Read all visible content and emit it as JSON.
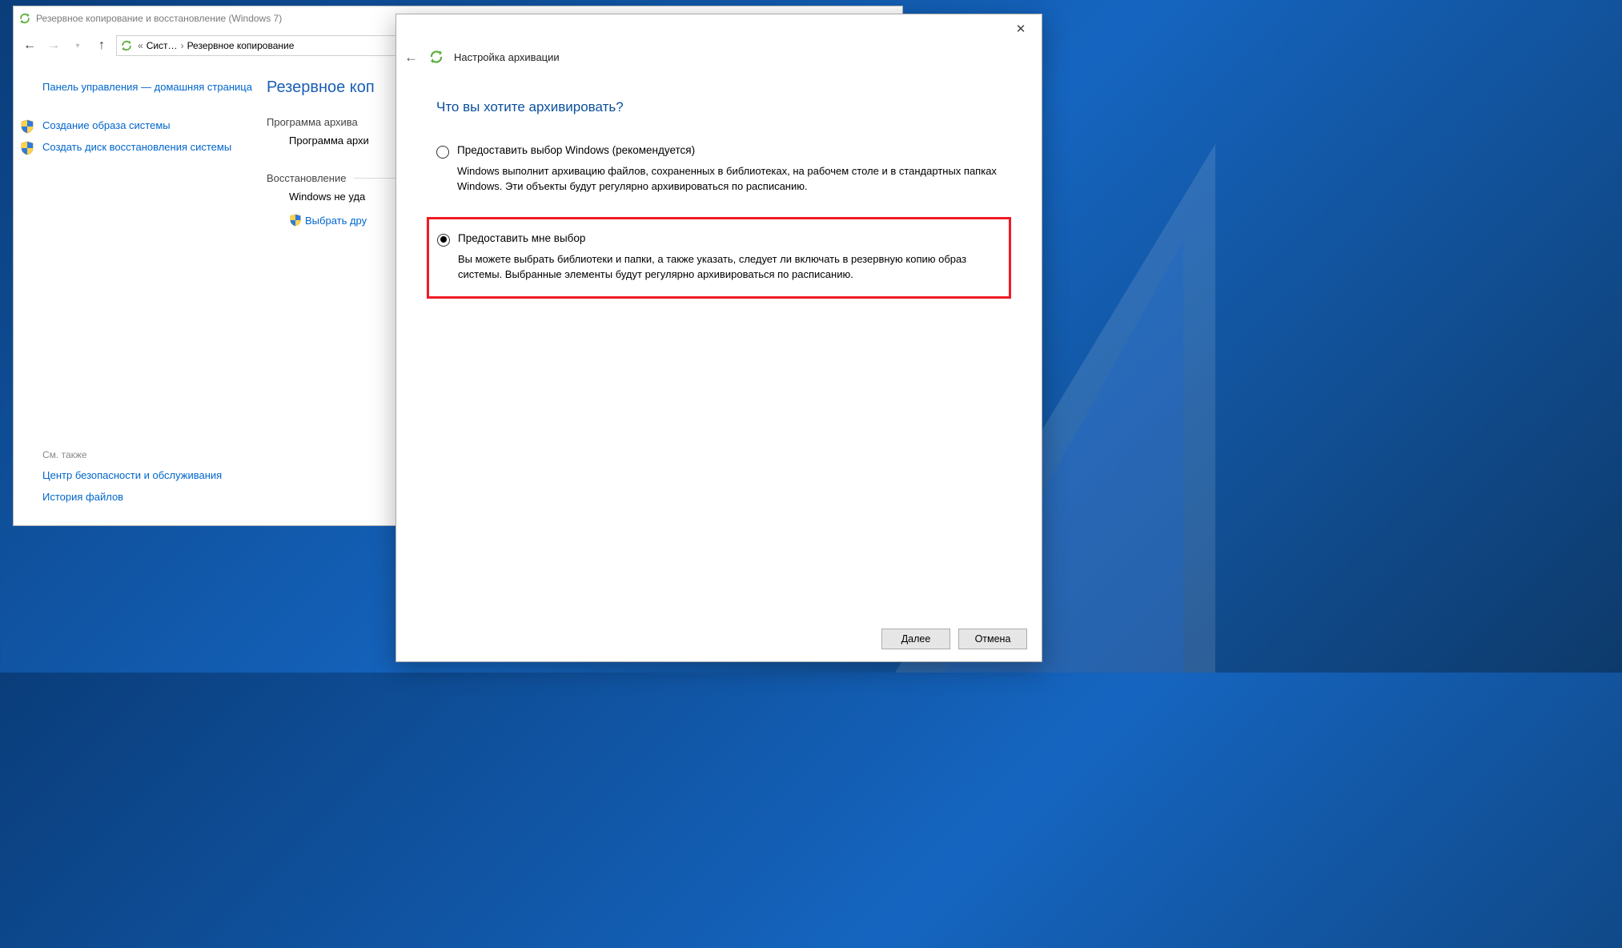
{
  "parent_window": {
    "title": "Резервное копирование и восстановление (Windows 7)",
    "breadcrumb": {
      "item1": "Сист…",
      "item2": "Резервное копирование"
    },
    "sidebar": {
      "home": "Панель управления — домашняя страница",
      "create_image": "Создание образа системы",
      "create_recovery_disk": "Создать диск восстановления системы",
      "see_also_label": "См. также",
      "security_center": "Центр безопасности и обслуживания",
      "file_history": "История файлов"
    },
    "main": {
      "title": "Резервное коп",
      "backup_section": "Программа архива",
      "backup_subline": "Программа архи",
      "restore_section": "Восстановление",
      "restore_line": "Windows не уда",
      "restore_link": "Выбрать дру"
    }
  },
  "dialog": {
    "header": "Настройка архивации",
    "heading": "Что вы хотите архивировать?",
    "option1": {
      "label": "Предоставить выбор Windows (рекомендуется)",
      "desc": "Windows выполнит архивацию файлов, сохраненных в библиотеках, на рабочем столе и в стандартных папках Windows. Эти объекты будут регулярно архивироваться по расписанию."
    },
    "option2": {
      "label": "Предоставить мне выбор",
      "desc": "Вы можете выбрать библиотеки и папки, а также указать, следует ли включать в резервную копию образ системы. Выбранные элементы будут регулярно архивироваться по расписанию."
    },
    "buttons": {
      "next": "Далее",
      "cancel": "Отмена"
    }
  }
}
